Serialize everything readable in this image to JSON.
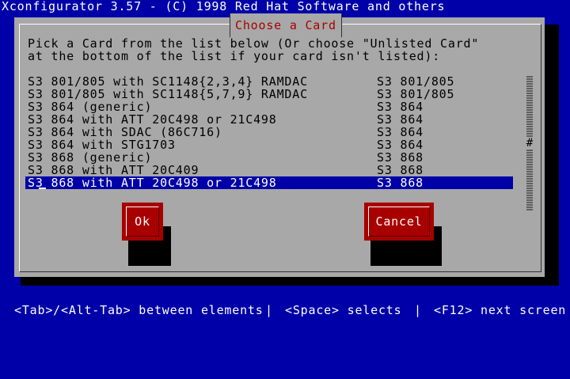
{
  "screen": {
    "title": "Xconfigurator 3.57 - (C) 1998 Red Hat Software and others"
  },
  "dialog": {
    "title": "Choose a Card",
    "prompt_line1": "Pick a Card from the list below (Or choose \"Unlisted Card\"",
    "prompt_line2": "at the bottom of the list if your card isn't listed):",
    "items": [
      {
        "name": "S3 801/805 with SC1148{2,3,4} RAMDAC",
        "chip": "S3 801/805"
      },
      {
        "name": "S3 801/805 with SC1148{5,7,9} RAMDAC",
        "chip": "S3 801/805"
      },
      {
        "name": "S3 864 (generic)",
        "chip": "S3 864"
      },
      {
        "name": "S3 864 with ATT 20C498 or 21C498",
        "chip": "S3 864"
      },
      {
        "name": "S3 864 with SDAC (86C716)",
        "chip": "S3 864"
      },
      {
        "name": "S3 864 with STG1703",
        "chip": "S3 864"
      },
      {
        "name": "S3 868 (generic)",
        "chip": "S3 868"
      },
      {
        "name": "S3 868 with ATT 20C409",
        "chip": "S3 868"
      },
      {
        "name": "S3 868 with ATT 20C498 or 21C498",
        "chip": "S3 868",
        "selected": true
      }
    ],
    "scroll_thumb": "#",
    "ok_label": "Ok",
    "cancel_label": "Cancel"
  },
  "footer": {
    "hint1": "<Tab>/<Alt-Tab> between elements",
    "sep1": "|",
    "hint2": "<Space> selects",
    "sep2": "|",
    "hint3": "<F12> next screen"
  },
  "colors": {
    "background": "#0000a8",
    "dialog": "#a8a8a8",
    "button": "#a80000",
    "title_text": "#a80000",
    "selection": "#0000a8"
  }
}
